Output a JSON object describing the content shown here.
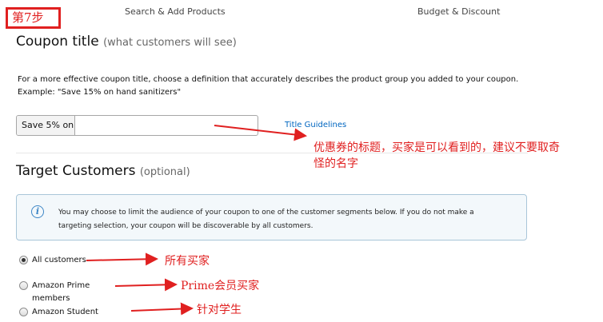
{
  "step_badge": "第7步",
  "steps_nav": {
    "step_search": "Search & Add Products",
    "step_budget": "Budget & Discount"
  },
  "coupon_title": {
    "heading": "Coupon title",
    "heading_hint": "(what customers will see)",
    "description_line1": "For a more effective coupon title, choose a definition that accurately describes the product group you added to your coupon.",
    "description_line2": "Example: \"Save 15% on hand sanitizers\"",
    "input_prefix": "Save 5% on",
    "input_value": "",
    "guidelines_link": "Title Guidelines"
  },
  "target_customers": {
    "heading": "Target Customers",
    "heading_hint": "(optional)",
    "info_text": "You may choose to limit the audience of your coupon to one of the customer segments below. If you do not make a targeting selection, your coupon will be discoverable by all customers.",
    "options": [
      {
        "label": "All customers",
        "checked": true
      },
      {
        "label": "Amazon Prime members",
        "checked": false
      },
      {
        "label": "Amazon Student",
        "checked": false
      }
    ]
  },
  "annotations": {
    "title_note_line1": "优惠券的标题，买家是可以看到的，建议不要取奇",
    "title_note_line2": "怪的名字",
    "all_note": "所有买家",
    "prime_note": "Prime会员买家",
    "student_note": "针对学生"
  },
  "colors": {
    "annotation": "#e02020",
    "link": "#0066c0",
    "info_border": "#a9c6d9"
  }
}
